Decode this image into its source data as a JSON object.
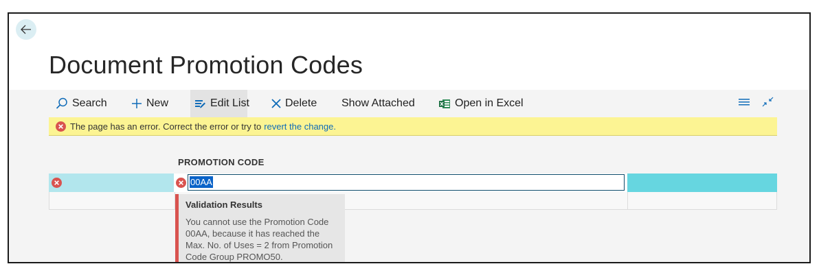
{
  "page": {
    "title": "Document Promotion Codes"
  },
  "actions": {
    "search": "Search",
    "new": "New",
    "edit_list": "Edit List",
    "delete": "Delete",
    "show_attached": "Show Attached",
    "open_in_excel": "Open in Excel"
  },
  "error_bar": {
    "message": "The page has an error. Correct the error or try to",
    "link": "revert the change."
  },
  "grid": {
    "column_header": "PROMOTION CODE",
    "current_value": "00AA"
  },
  "validation": {
    "title": "Validation Results",
    "message": "You cannot use the Promotion Code 00AA, because it has reached the Max. No. of Uses = 2 from Promotion Code Group PROMO50."
  },
  "colors": {
    "error_red": "#d9534f",
    "warning_yellow": "#fcf493",
    "accent_cyan": "#66d6e0",
    "excel_green": "#1e7145"
  },
  "icons": [
    "back-arrow-icon",
    "search-icon",
    "plus-icon",
    "edit-list-icon",
    "x-icon",
    "excel-icon",
    "error-icon",
    "list-view-icon",
    "collapse-icon"
  ]
}
